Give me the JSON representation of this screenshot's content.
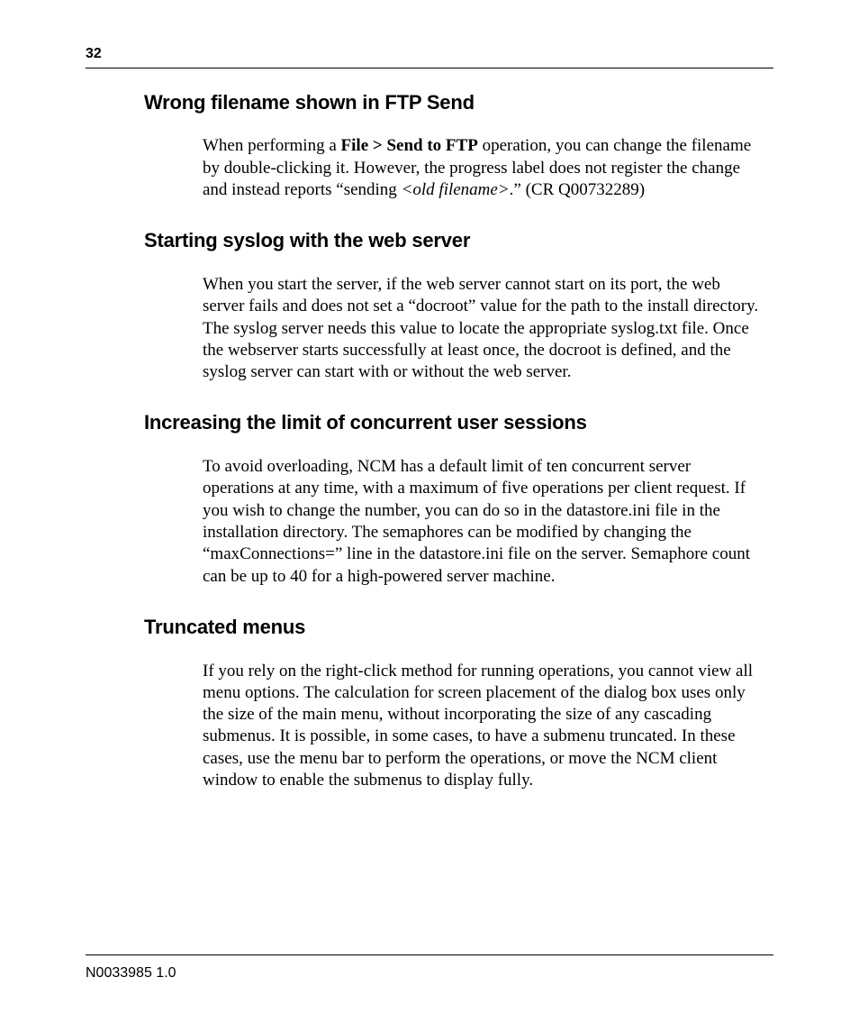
{
  "page_number": "32",
  "sections": {
    "s1": {
      "heading": "Wrong filename shown in FTP Send",
      "para_lead": "When performing a ",
      "menu_path": "File > Send to FTP",
      "para_mid": " operation, you can change the filename by double-clicking it. However, the progress label does not register the change and instead reports “sending ",
      "placeholder": "<old filename>",
      "para_tail": ".” (CR Q00732289)"
    },
    "s2": {
      "heading": "Starting syslog with the web server",
      "para": "When you start the server, if the web server cannot start on its port, the web server fails and does not set a “docroot” value for the path to the install directory. The syslog server needs this value to locate the appropriate syslog.txt file. Once the webserver starts successfully at least once, the docroot is defined, and the syslog server can start with or without the web server."
    },
    "s3": {
      "heading": "Increasing the limit of concurrent user sessions",
      "para": "To avoid overloading, NCM has a default limit of ten concurrent server operations at any time, with a maximum of five operations per client request. If you wish to change the number, you can do so in the datastore.ini file in the installation directory. The semaphores can be modified by changing the “maxConnections=” line in the datastore.ini file on the server. Semaphore count can be up to 40 for a high-powered server machine."
    },
    "s4": {
      "heading": "Truncated menus",
      "para": "If you rely on the right-click method for running operations, you cannot view all menu options. The calculation for screen placement of the dialog box uses only the size of the main menu, without incorporating the size of any cascading submenus. It is possible, in some cases, to have a submenu truncated. In these cases, use the menu bar to perform the operations, or move the NCM client window to enable the submenus to display fully."
    }
  },
  "footer": "N0033985 1.0"
}
